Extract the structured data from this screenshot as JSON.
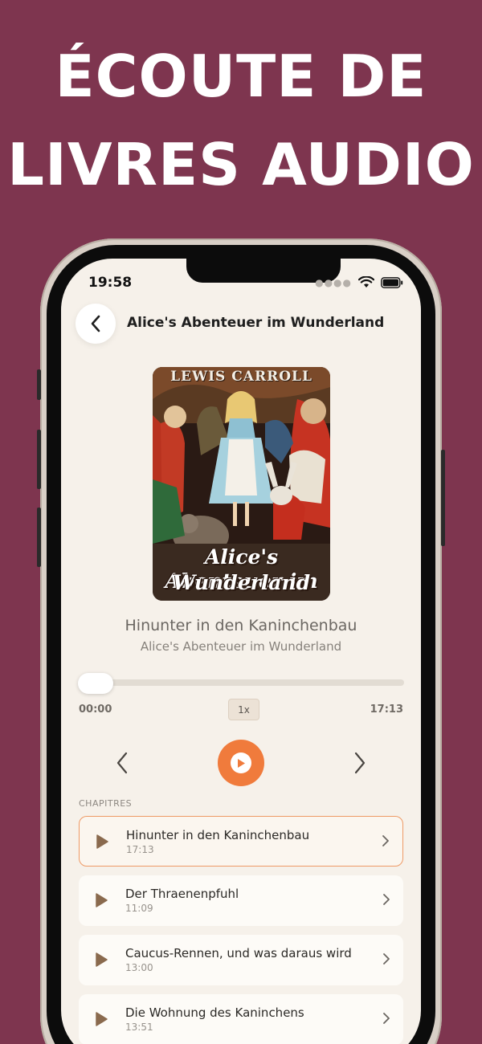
{
  "headline": {
    "line1": "ÉCOUTE DE",
    "line2": "LIVRES AUDIO"
  },
  "colors": {
    "background": "#7e354f",
    "accent": "#f07b3c",
    "screen": "#f6f1ea"
  },
  "status_bar": {
    "time": "19:58",
    "icons": [
      "signal-dots-icon",
      "wifi-icon",
      "battery-icon"
    ]
  },
  "nav": {
    "back_icon": "chevron-left-icon",
    "title": "Alice's Abenteuer im Wunderland"
  },
  "cover": {
    "author": "LEWIS CARROLL",
    "title_line1": "Alice's Abenteuer im",
    "title_line2": "Wunderland"
  },
  "now_playing": {
    "title": "Hinunter in den Kaninchenbau",
    "book": "Alice's Abenteuer im Wunderland",
    "elapsed": "00:00",
    "duration": "17:13",
    "progress": 0.0,
    "speed": "1x"
  },
  "controls": {
    "prev_icon": "chevron-left-icon",
    "play_icon": "play-icon",
    "next_icon": "chevron-right-icon"
  },
  "chapters_label": "CHAPITRES",
  "chapters": [
    {
      "title": "Hinunter in den Kaninchenbau",
      "duration": "17:13",
      "active": true
    },
    {
      "title": "Der Thraenenpfuhl",
      "duration": "11:09",
      "active": false
    },
    {
      "title": "Caucus-Rennen, und was daraus wird",
      "duration": "13:00",
      "active": false
    },
    {
      "title": "Die Wohnung des Kaninchens",
      "duration": "13:51",
      "active": false
    }
  ]
}
